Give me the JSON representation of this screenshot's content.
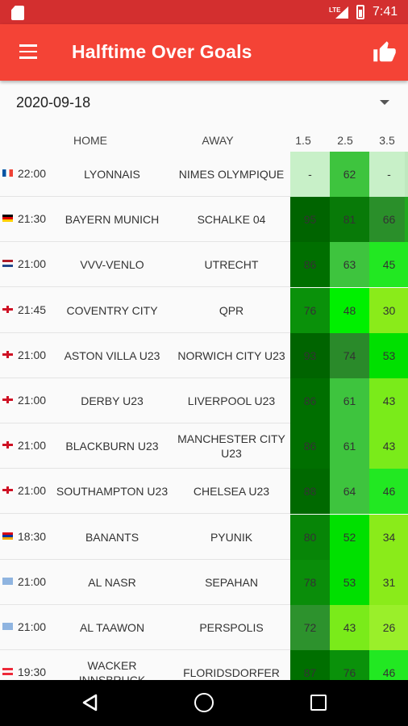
{
  "status_bar": {
    "network": "LTE",
    "time": "7:41"
  },
  "app_bar": {
    "title": "Halftime Over Goals"
  },
  "date_selector": {
    "selected": "2020-09-18"
  },
  "table": {
    "headers": {
      "home": "HOME",
      "away": "AWAY",
      "col1": "1.5",
      "col2": "2.5",
      "col3": "3.5"
    },
    "rows": [
      {
        "flag": "france-flag-icon",
        "time": "22:00",
        "home": "LYONNAIS",
        "away": "NIMES OLYMPIQUE",
        "v1": "-",
        "v2": "62",
        "v3": "-",
        "bg1": "#c8f0c8",
        "bg2": "#3ec43e",
        "bg3": "#c8f0c8",
        "bg4": "#bfe8bf"
      },
      {
        "flag": "germany-flag-icon",
        "time": "21:30",
        "home": "BAYERN MUNICH",
        "away": "SCHALKE 04",
        "v1": "95",
        "v2": "81",
        "v3": "66",
        "bg1": "#006400",
        "bg2": "#087a08",
        "bg3": "#2a8f2a",
        "bg4": "#1faa1f"
      },
      {
        "flag": "netherlands-flag-icon",
        "time": "21:00",
        "home": "VVV-VENLO",
        "away": "UTRECHT",
        "v1": "86",
        "v2": "63",
        "v3": "45",
        "bg1": "#006f00",
        "bg2": "#3ec43e",
        "bg3": "#22e822",
        "bg4": "#22e822"
      },
      {
        "flag": "england-flag-icon",
        "time": "21:45",
        "home": "COVENTRY CITY",
        "away": "QPR",
        "v1": "76",
        "v2": "48",
        "v3": "30",
        "bg1": "#0a910a",
        "bg2": "#00f000",
        "bg3": "#8aeb1a",
        "bg4": "#8aeb1a"
      },
      {
        "flag": "england-flag-icon",
        "time": "21:00",
        "home": "ASTON VILLA U23",
        "away": "NORWICH CITY U23",
        "v1": "93",
        "v2": "74",
        "v3": "53",
        "bg1": "#006400",
        "bg2": "#2a8a2a",
        "bg3": "#00e000",
        "bg4": "#00e000"
      },
      {
        "flag": "england-flag-icon",
        "time": "21:00",
        "home": "DERBY U23",
        "away": "LIVERPOOL U23",
        "v1": "86",
        "v2": "61",
        "v3": "43",
        "bg1": "#006f00",
        "bg2": "#3ec43e",
        "bg3": "#7aeb1a",
        "bg4": "#7aeb1a"
      },
      {
        "flag": "england-flag-icon",
        "time": "21:00",
        "home": "BLACKBURN U23",
        "away": "MANCHESTER CITY U23",
        "v1": "86",
        "v2": "61",
        "v3": "43",
        "bg1": "#006f00",
        "bg2": "#3ec43e",
        "bg3": "#7aeb1a",
        "bg4": "#7aeb1a"
      },
      {
        "flag": "england-flag-icon",
        "time": "21:00",
        "home": "SOUTHAMPTON U23",
        "away": "CHELSEA U23",
        "v1": "88",
        "v2": "64",
        "v3": "46",
        "bg1": "#006900",
        "bg2": "#3ec43e",
        "bg3": "#22e822",
        "bg4": "#22e822"
      },
      {
        "flag": "armenia-flag-icon",
        "time": "18:30",
        "home": "BANANTS",
        "away": "PYUNIK",
        "v1": "80",
        "v2": "52",
        "v3": "34",
        "bg1": "#078507",
        "bg2": "#00e000",
        "bg3": "#8aeb1a",
        "bg4": "#8aeb1a"
      },
      {
        "flag": "saudi-flag-icon",
        "time": "21:00",
        "home": "AL NASR",
        "away": "SEPAHAN",
        "v1": "78",
        "v2": "53",
        "v3": "31",
        "bg1": "#0a8d0a",
        "bg2": "#00e000",
        "bg3": "#8aeb1a",
        "bg4": "#8aeb1a"
      },
      {
        "flag": "saudi-flag-icon",
        "time": "21:00",
        "home": "AL TAAWON",
        "away": "PERSPOLIS",
        "v1": "72",
        "v2": "43",
        "v3": "26",
        "bg1": "#2d922d",
        "bg2": "#7aeb1a",
        "bg3": "#9aef2a",
        "bg4": "#9aef2a"
      },
      {
        "flag": "austria-flag-icon",
        "time": "19:30",
        "home": "WACKER INNSBRUCK",
        "away": "FLORIDSDORFER",
        "v1": "87",
        "v2": "76",
        "v3": "46",
        "bg1": "#006f00",
        "bg2": "#0a910a",
        "bg3": "#22e822",
        "bg4": "#22e822"
      }
    ]
  }
}
